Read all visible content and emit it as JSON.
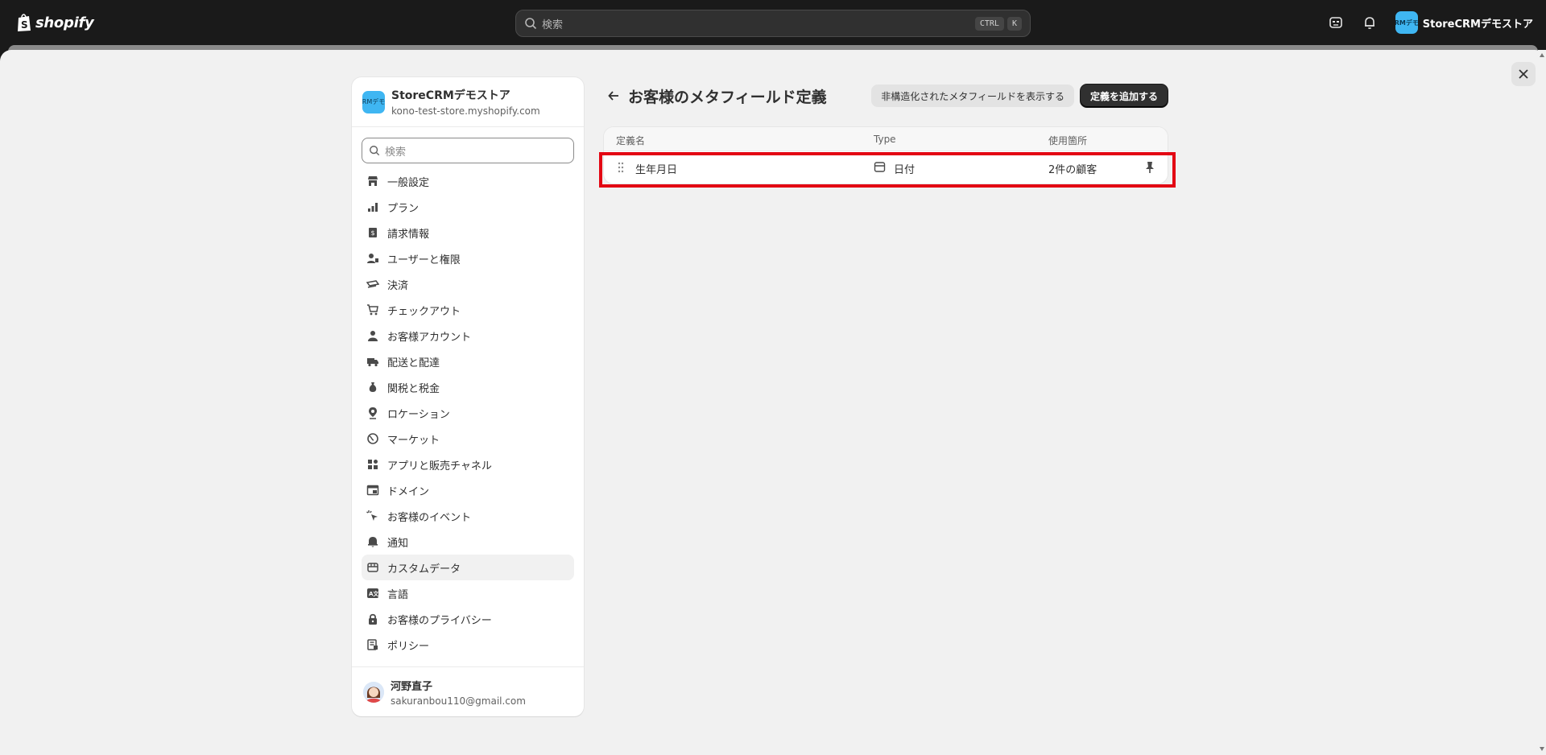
{
  "topbar": {
    "brand": "shopify",
    "search_placeholder": "検索",
    "shortcut_keys": [
      "CTRL",
      "K"
    ],
    "store_avatar_text": "RMデモ",
    "store_name": "StoreCRMデモストア"
  },
  "sidebar": {
    "store_avatar_text": "RMデモ",
    "store_name": "StoreCRMデモストア",
    "store_url": "kono-test-store.myshopify.com",
    "search_placeholder": "検索",
    "items": [
      {
        "label": "一般設定",
        "icon": "store-icon"
      },
      {
        "label": "プラン",
        "icon": "plan-icon"
      },
      {
        "label": "請求情報",
        "icon": "billing-icon"
      },
      {
        "label": "ユーザーと権限",
        "icon": "users-icon"
      },
      {
        "label": "決済",
        "icon": "payments-icon"
      },
      {
        "label": "チェックアウト",
        "icon": "cart-icon"
      },
      {
        "label": "お客様アカウント",
        "icon": "person-icon"
      },
      {
        "label": "配送と配達",
        "icon": "truck-icon"
      },
      {
        "label": "関税と税金",
        "icon": "tax-icon"
      },
      {
        "label": "ロケーション",
        "icon": "location-icon"
      },
      {
        "label": "マーケット",
        "icon": "globe-icon"
      },
      {
        "label": "アプリと販売チャネル",
        "icon": "apps-icon"
      },
      {
        "label": "ドメイン",
        "icon": "domain-icon"
      },
      {
        "label": "お客様のイベント",
        "icon": "cursor-icon"
      },
      {
        "label": "通知",
        "icon": "bell-icon"
      },
      {
        "label": "カスタムデータ",
        "icon": "database-icon",
        "active": true
      },
      {
        "label": "言語",
        "icon": "language-icon"
      },
      {
        "label": "お客様のプライバシー",
        "icon": "lock-icon"
      },
      {
        "label": "ポリシー",
        "icon": "policy-icon"
      }
    ],
    "user_name": "河野直子",
    "user_email": "sakuranbou110@gmail.com"
  },
  "main": {
    "title": "お客様のメタフィールド定義",
    "show_unstructured_label": "非構造化されたメタフィールドを表示する",
    "add_definition_label": "定義を追加する",
    "table": {
      "columns": [
        "定義名",
        "Type",
        "使用箇所"
      ],
      "rows": [
        {
          "name": "生年月日",
          "type": "日付",
          "usage": "2件の顧客"
        }
      ]
    }
  },
  "colors": {
    "topbar_bg": "#1a1a1a",
    "highlight": "#e30613",
    "store_avatar": "#3fb6f2",
    "primary_button": "#303030"
  }
}
